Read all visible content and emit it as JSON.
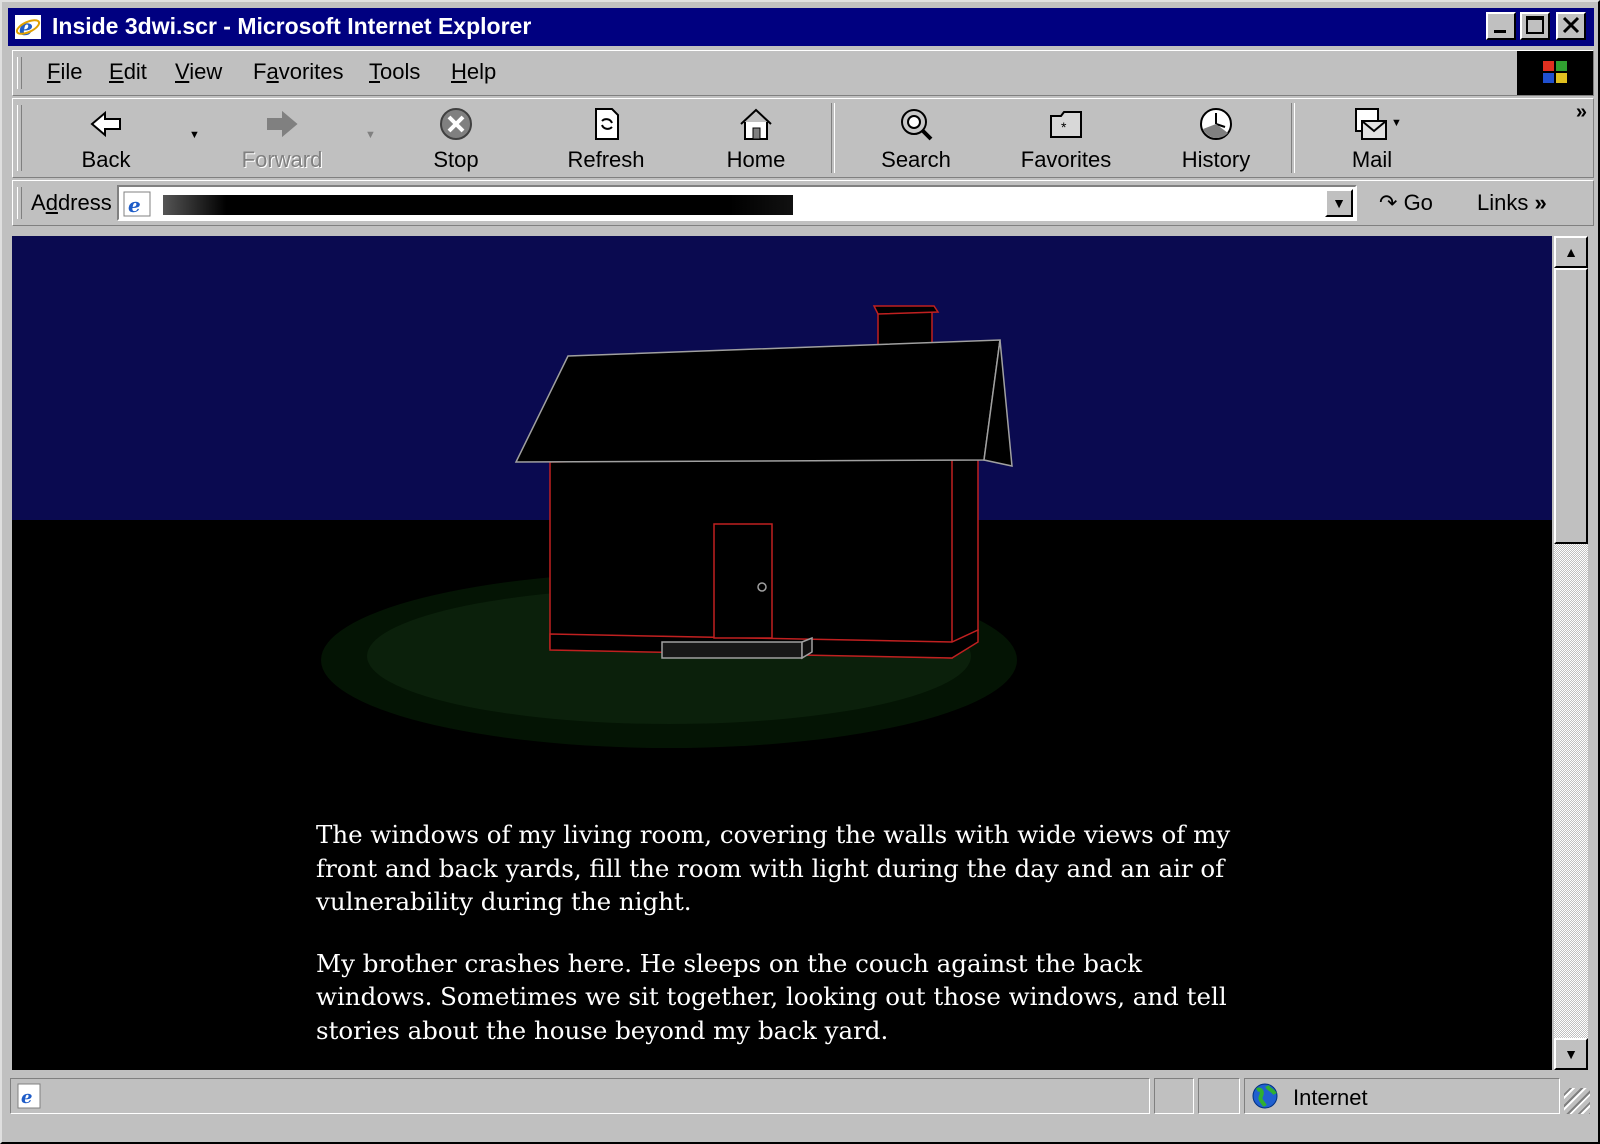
{
  "window": {
    "title": "Inside 3dwi.scr - Microsoft Internet Explorer"
  },
  "menu": {
    "file": "File",
    "file_key": "F",
    "file_rest": "ile",
    "edit": "Edit",
    "edit_key": "E",
    "edit_rest": "dit",
    "view": "View",
    "view_key": "V",
    "view_rest": "iew",
    "favorites_pre": "F",
    "favorites_key": "a",
    "favorites_rest": "vorites",
    "tools_key": "T",
    "tools_rest": "ools",
    "help_key": "H",
    "help_rest": "elp"
  },
  "toolbar": {
    "back": "Back",
    "forward": "Forward",
    "stop": "Stop",
    "refresh": "Refresh",
    "home": "Home",
    "search": "Search",
    "favorites": "Favorites",
    "history": "History",
    "mail": "Mail",
    "more": "»"
  },
  "address": {
    "label_pre": "A",
    "label_key": "d",
    "label_rest": "dress",
    "go": "Go",
    "links": "Links",
    "links_more": "»"
  },
  "page": {
    "paragraphs": [
      "The windows of my living room, covering the walls with wide views of my front and back yards, fill the room with light during the day and an air of vulnerability during the night.",
      "My brother crashes here. He sleeps on the couch against the back windows. Sometimes we sit together, looking out those windows, and tell stories about the house beyond my back yard."
    ]
  },
  "status": {
    "zone": "Internet"
  },
  "colors": {
    "titlebar": "#000080",
    "sky": "#0a0a50",
    "ground": "#000000",
    "house_edges": "#c02020",
    "lawn": "#0b200b"
  }
}
